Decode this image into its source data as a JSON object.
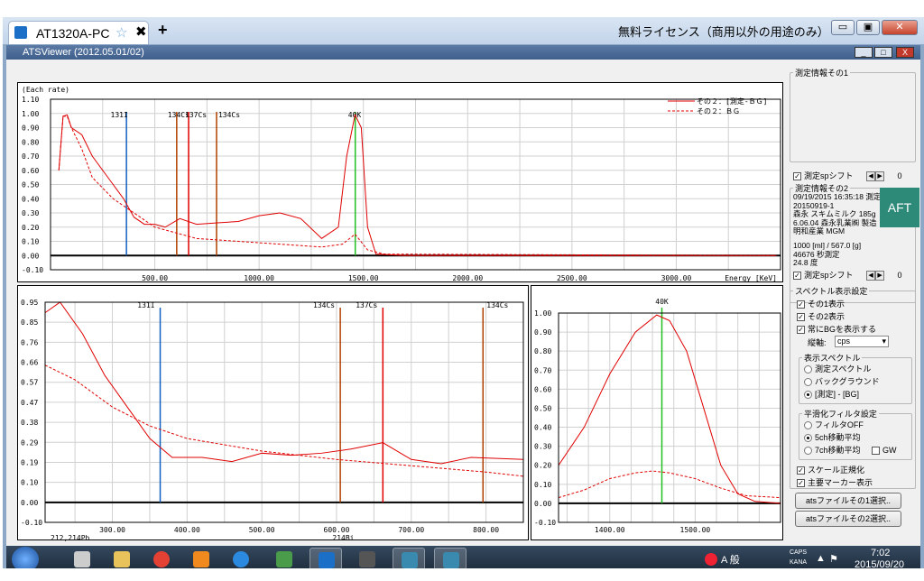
{
  "browser": {
    "tab_title": "AT1320A-PC",
    "new_tab": "+",
    "tab_close": "✖",
    "license": "無料ライセンス（商用以外の用途のみ）",
    "min": "▭",
    "max": "▣",
    "close": "✕"
  },
  "app": {
    "title": "ATSViewer (2012.05.01/02)",
    "min": "_",
    "max": "□",
    "close": "X"
  },
  "top_plot": {
    "ylabel": "(Each rate)",
    "xlabel": "Energy [KeV]",
    "yticks": [
      "1.10",
      "1.00",
      "0.90",
      "0.80",
      "0.70",
      "0.60",
      "0.50",
      "0.40",
      "0.30",
      "0.20",
      "0.10",
      "0.00",
      "-0.10"
    ],
    "xticks": [
      "500.00",
      "1000.00",
      "1500.00",
      "2000.00",
      "2500.00",
      "3000.00"
    ],
    "markers": [
      "131I",
      "134Cs",
      "137Cs",
      "134Cs",
      "40K"
    ],
    "legend": [
      "その２：[測定-ＢＧ]",
      "その２：ＢＧ"
    ]
  },
  "left_plot": {
    "yticks": [
      "0.95",
      "0.85",
      "0.76",
      "0.66",
      "0.57",
      "0.47",
      "0.38",
      "0.29",
      "0.19",
      "0.10",
      "0.00",
      "-0.10"
    ],
    "xticks": [
      "300.00",
      "400.00",
      "500.00",
      "600.00",
      "700.00",
      "800.00"
    ],
    "markers": [
      "131I",
      "134Cs",
      "137Cs",
      "134Cs"
    ],
    "pb": "212,214Pb",
    "bi": "214Bi"
  },
  "right_plot": {
    "yticks": [
      "1.00",
      "0.90",
      "0.80",
      "0.70",
      "0.60",
      "0.50",
      "0.40",
      "0.30",
      "0.20",
      "0.10",
      "0.00",
      "-0.10"
    ],
    "xticks": [
      "1400.00",
      "1500.00"
    ],
    "markers": [
      "40K"
    ]
  },
  "side": {
    "info1": "測定情報その1",
    "sp_shift": "測定spシフト",
    "shift_val": "0",
    "info2": "測定情報その2",
    "info2_text": "09/19/2015 16:35:18 測定\n20150919-1\n森永 スキムミルク 185g\n6.06.04 森永乳業㈱ 製造\n明和産業 MGM",
    "info2_text2": "1000 [ml] / 567.0 [g]\n46676 秒測定\n24.8 度",
    "spectrum_group": "スペクトル表示設定",
    "show1": "その1表示",
    "show2": "その2表示",
    "show_bg": "常にBGを表示する",
    "yaxis_label": "縦軸:",
    "yaxis_val": "cps",
    "disp_group": "表示スペクトル",
    "opt_meas": "測定スペクトル",
    "opt_bg": "バックグラウンド",
    "opt_diff": "[測定] - [BG]",
    "smooth_group": "平滑化フィルタ設定",
    "filter_off": "フィルタOFF",
    "ma5": "5ch移動平均",
    "ma7": "7ch移動平均",
    "gw": "GW",
    "scale_norm": "スケール正規化",
    "main_marker": "主要マーカー表示",
    "file1": "atsファイルその1選択..",
    "file2": "atsファイルその2選択.."
  },
  "taskbar": {
    "time": "7:02",
    "date": "2015/09/20",
    "ime": "A 般",
    "caps": "CAPS",
    "kana": "KANA"
  },
  "colors": {
    "measured": "#e00000",
    "cs134": "#b04000",
    "cs137": "#e00000",
    "i131": "#1060c0",
    "k40": "#20c020"
  }
}
